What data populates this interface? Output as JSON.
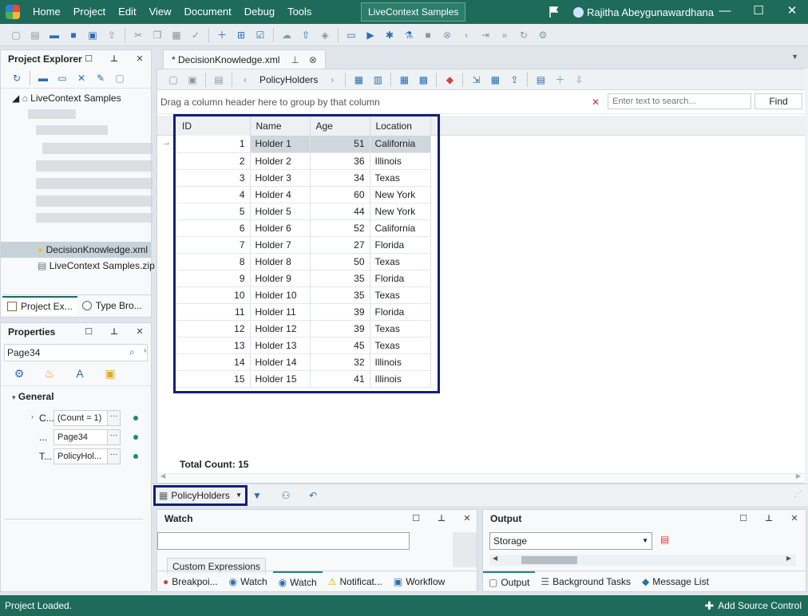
{
  "menu": [
    "Home",
    "Project",
    "Edit",
    "View",
    "Document",
    "Debug",
    "Tools"
  ],
  "title_center": "LiveContext Samples",
  "user_name": "Rajitha Abeygunawardhana",
  "window_controls": {
    "minimize": "—",
    "maximize": "☐",
    "close": "✕"
  },
  "project_explorer": {
    "title": "Project Explorer",
    "root": "LiveContext Samples",
    "items": [
      "DecisionKnowledge.xml",
      "LiveContext Samples.zip"
    ],
    "tabs": [
      "Project Ex...",
      "Type Bro..."
    ]
  },
  "properties": {
    "title": "Properties",
    "search_value": "Page34",
    "section": "General",
    "rows": [
      {
        "name": "C...",
        "value": "(Count = 1)"
      },
      {
        "name": "...",
        "value": "Page34"
      },
      {
        "name": "T...",
        "value": "PolicyHol..."
      }
    ]
  },
  "document": {
    "tab_title": "* DecisionKnowledge.xml",
    "toolbar_label": "PolicyHolders",
    "group_hint": "Drag a column header here to group by that column",
    "search_placeholder": "Enter text to search...",
    "find_label": "Find",
    "clear_icon": "✕",
    "columns": [
      "ID",
      "Name",
      "Age",
      "Location"
    ],
    "rows": [
      {
        "id": "1",
        "name": "Holder 1",
        "age": "51",
        "location": "California"
      },
      {
        "id": "2",
        "name": "Holder 2",
        "age": "36",
        "location": "Illinois"
      },
      {
        "id": "3",
        "name": "Holder 3",
        "age": "34",
        "location": "Texas"
      },
      {
        "id": "4",
        "name": "Holder 4",
        "age": "60",
        "location": "New York"
      },
      {
        "id": "5",
        "name": "Holder 5",
        "age": "44",
        "location": "New York"
      },
      {
        "id": "6",
        "name": "Holder 6",
        "age": "52",
        "location": "California"
      },
      {
        "id": "7",
        "name": "Holder 7",
        "age": "27",
        "location": "Florida"
      },
      {
        "id": "8",
        "name": "Holder 8",
        "age": "50",
        "location": "Texas"
      },
      {
        "id": "9",
        "name": "Holder 9",
        "age": "35",
        "location": "Florida"
      },
      {
        "id": "10",
        "name": "Holder 10",
        "age": "35",
        "location": "Texas"
      },
      {
        "id": "11",
        "name": "Holder 11",
        "age": "39",
        "location": "Florida"
      },
      {
        "id": "12",
        "name": "Holder 12",
        "age": "39",
        "location": "Texas"
      },
      {
        "id": "13",
        "name": "Holder 13",
        "age": "45",
        "location": "Texas"
      },
      {
        "id": "14",
        "name": "Holder 14",
        "age": "32",
        "location": "Illinois"
      },
      {
        "id": "15",
        "name": "Holder 15",
        "age": "41",
        "location": "Illinois"
      }
    ],
    "total_count": "Total Count: 15"
  },
  "datasource": {
    "label": "PolicyHolders"
  },
  "watch": {
    "title": "Watch",
    "custom_tab": "Custom Expressions",
    "tabs": [
      "Breakpoi...",
      "Watch",
      "Watch",
      "Notificat...",
      "Workflow"
    ]
  },
  "output": {
    "title": "Output",
    "select_value": "Storage",
    "tabs": [
      "Output",
      "Background Tasks",
      "Message List"
    ]
  },
  "status": {
    "text": "Project Loaded.",
    "source_control": "Add Source Control"
  },
  "colors": {
    "title_bar": "#1e6b5b",
    "highlight": "#141f7a",
    "accent": "#1e8a74"
  }
}
